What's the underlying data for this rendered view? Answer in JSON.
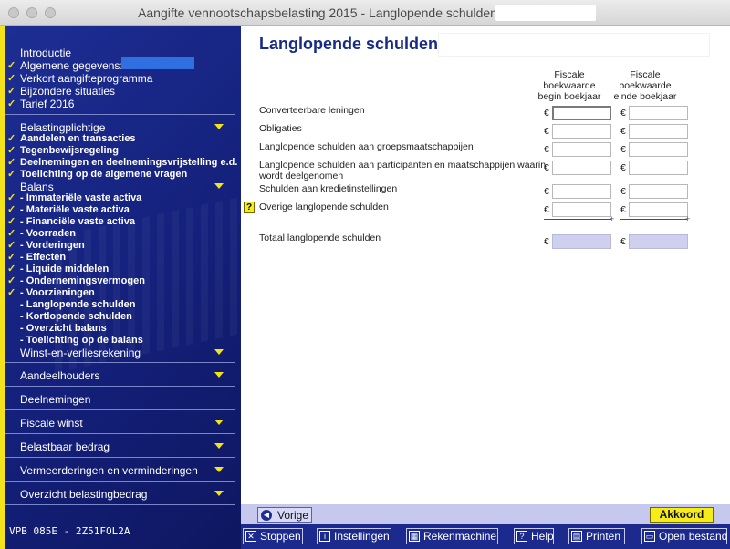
{
  "window": {
    "title": "Aangifte vennootschapsbelasting 2015 - Langlopende schulden"
  },
  "sidebar": {
    "items": [
      {
        "label": "Introductie",
        "checked": false,
        "arrow": false
      },
      {
        "label": "Algemene gegevens:",
        "checked": true,
        "arrow": false
      },
      {
        "label": "Verkort aangifteprogramma",
        "checked": true,
        "arrow": false
      },
      {
        "label": "Bijzondere situaties",
        "checked": true,
        "arrow": false
      },
      {
        "label": "Tarief 2016",
        "checked": true,
        "arrow": false
      },
      {
        "label": "Belastingplichtige",
        "checked": false,
        "arrow": true
      },
      {
        "label": "Aandelen en transacties",
        "checked": true,
        "arrow": false
      },
      {
        "label": "Tegenbewijsregeling",
        "checked": true,
        "arrow": false
      },
      {
        "label": "Deelnemingen en deelnemingsvrijstelling e.d.",
        "checked": true,
        "arrow": false
      },
      {
        "label": "Toelichting op de algemene vragen",
        "checked": true,
        "arrow": false
      },
      {
        "label": "Balans",
        "checked": false,
        "arrow": true
      },
      {
        "label": "- Immateriële vaste activa",
        "checked": true,
        "arrow": false
      },
      {
        "label": "- Materiële vaste activa",
        "checked": true,
        "arrow": false
      },
      {
        "label": "- Financiële vaste activa",
        "checked": true,
        "arrow": false
      },
      {
        "label": "- Voorraden",
        "checked": true,
        "arrow": false
      },
      {
        "label": "- Vorderingen",
        "checked": true,
        "arrow": false
      },
      {
        "label": "- Effecten",
        "checked": true,
        "arrow": false
      },
      {
        "label": "- Liquide middelen",
        "checked": true,
        "arrow": false
      },
      {
        "label": "- Ondernemingsvermogen",
        "checked": true,
        "arrow": false
      },
      {
        "label": "- Voorzieningen",
        "checked": true,
        "arrow": false
      },
      {
        "label": "- Langlopende schulden",
        "checked": false,
        "arrow": false,
        "active": true
      },
      {
        "label": "- Kortlopende schulden",
        "checked": false,
        "arrow": false
      },
      {
        "label": "- Overzicht balans",
        "checked": false,
        "arrow": false
      },
      {
        "label": "- Toelichting op de balans",
        "checked": false,
        "arrow": false
      },
      {
        "label": "Winst-en-verliesrekening",
        "checked": false,
        "arrow": true
      }
    ],
    "sections": [
      {
        "label": "Aandeelhouders",
        "arrow": true
      },
      {
        "label": "Deelnemingen",
        "arrow": false
      },
      {
        "label": "Fiscale winst",
        "arrow": true
      },
      {
        "label": "Belastbaar bedrag",
        "arrow": true
      },
      {
        "label": "Vermeerderingen en verminderingen",
        "arrow": true
      },
      {
        "label": "Overzicht belastingbedrag",
        "arrow": true
      }
    ],
    "version": "VPB 085E - 2Z51FOL2A"
  },
  "main": {
    "title": "Langlopende schulden",
    "col1_header": [
      "Fiscale",
      "boekwaarde",
      "begin boekjaar"
    ],
    "col2_header": [
      "Fiscale",
      "boekwaarde",
      "einde boekjaar"
    ],
    "currency": "€",
    "help_label": "?",
    "rows": [
      {
        "label": "Converteerbare leningen",
        "begin": "",
        "einde": ""
      },
      {
        "label": "Obligaties",
        "begin": "",
        "einde": ""
      },
      {
        "label": "Langlopende schulden aan groepsmaatschappijen",
        "begin": "",
        "einde": ""
      },
      {
        "label": "Langlopende schulden aan participanten en maatschappijen waarin wordt deelgenomen",
        "begin": "",
        "einde": ""
      },
      {
        "label": "Schulden aan kredietinstellingen",
        "begin": "",
        "einde": ""
      },
      {
        "label": "Overige langlopende schulden",
        "begin": "",
        "einde": ""
      }
    ],
    "total": {
      "label": "Totaal langlopende schulden",
      "begin": "",
      "einde": ""
    },
    "plus_sign": "+"
  },
  "nav": {
    "prev_label": "Vorige",
    "next_label": "Akkoord"
  },
  "toolbar": {
    "buttons": [
      {
        "label": "Stoppen",
        "icon": "close-icon"
      },
      {
        "label": "Instellingen",
        "icon": "info-icon"
      },
      {
        "label": "Rekenmachine",
        "icon": "calculator-icon"
      },
      {
        "label": "Help",
        "icon": "help-icon"
      },
      {
        "label": "Printen",
        "icon": "printer-icon"
      },
      {
        "label": "Open bestand",
        "icon": "folder-icon"
      }
    ]
  },
  "colors": {
    "sidebar": "#1d2e94",
    "accent": "#f2e31a",
    "active": "#e8680a",
    "title": "#162a86"
  }
}
